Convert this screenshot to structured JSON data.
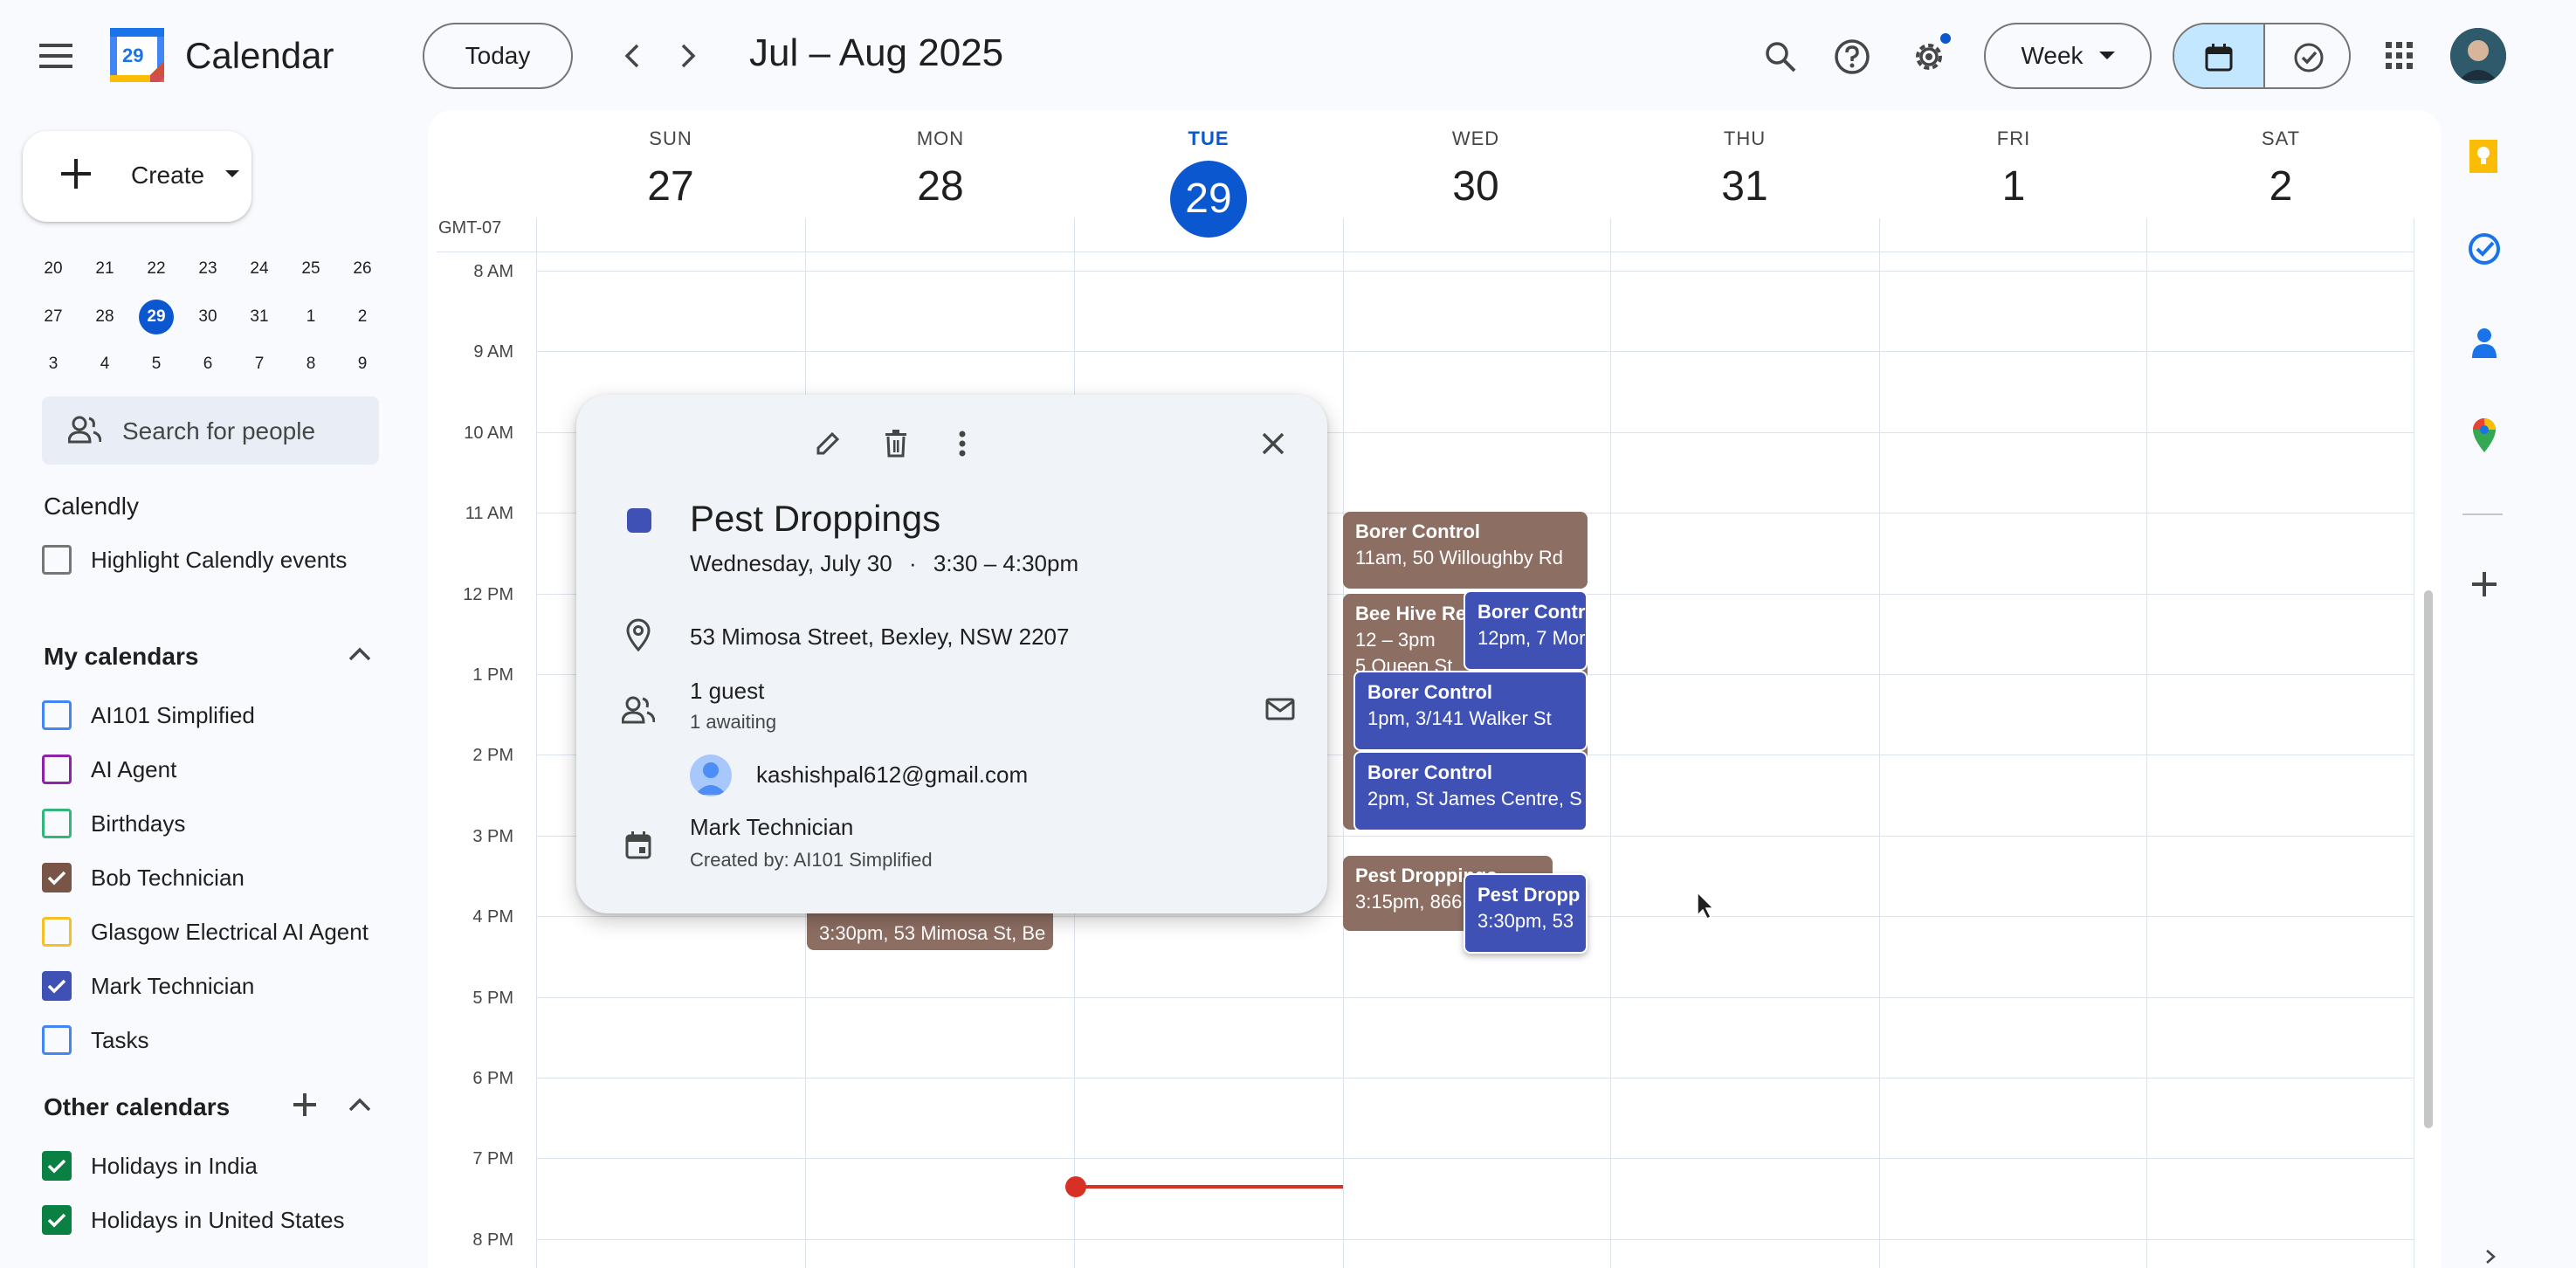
{
  "header": {
    "app_title": "Calendar",
    "logo_day": "29",
    "today_label": "Today",
    "date_range": "Jul – Aug 2025",
    "view_label": "Week"
  },
  "sidebar": {
    "create_label": "Create",
    "mini_calendar": {
      "rows": [
        [
          "20",
          "21",
          "22",
          "23",
          "24",
          "25",
          "26"
        ],
        [
          "27",
          "28",
          "29",
          "30",
          "31",
          "1",
          "2"
        ],
        [
          "3",
          "4",
          "5",
          "6",
          "7",
          "8",
          "9"
        ]
      ],
      "today": "29"
    },
    "search_people_placeholder": "Search for people",
    "calendly": {
      "title": "Calendly",
      "highlight_label": "Highlight Calendly events"
    },
    "my_calendars": {
      "title": "My calendars",
      "items": [
        {
          "label": "AI101 Simplified",
          "color": "#4285f4",
          "checked": false
        },
        {
          "label": "AI Agent",
          "color": "#8e24aa",
          "checked": false
        },
        {
          "label": "Birthdays",
          "color": "#33b679",
          "checked": false
        },
        {
          "label": "Bob Technician",
          "color": "#795548",
          "checked": true
        },
        {
          "label": "Glasgow Electrical AI Agent",
          "color": "#f6bf26",
          "checked": false
        },
        {
          "label": "Mark Technician",
          "color": "#3f51b5",
          "checked": true
        },
        {
          "label": "Tasks",
          "color": "#4285f4",
          "checked": false
        }
      ]
    },
    "other_calendars": {
      "title": "Other calendars",
      "items": [
        {
          "label": "Holidays in India",
          "color": "#0b8043",
          "checked": true
        },
        {
          "label": "Holidays in United States",
          "color": "#0b8043",
          "checked": true
        }
      ]
    }
  },
  "week": {
    "timezone": "GMT-07",
    "days": [
      {
        "name": "SUN",
        "date": "27"
      },
      {
        "name": "MON",
        "date": "28"
      },
      {
        "name": "TUE",
        "date": "29"
      },
      {
        "name": "WED",
        "date": "30"
      },
      {
        "name": "THU",
        "date": "31"
      },
      {
        "name": "FRI",
        "date": "1"
      },
      {
        "name": "SAT",
        "date": "2"
      }
    ],
    "today_index": 2,
    "times": [
      "8 AM",
      "9 AM",
      "10 AM",
      "11 AM",
      "12 PM",
      "1 PM",
      "2 PM",
      "3 PM",
      "4 PM",
      "5 PM",
      "6 PM",
      "7 PM",
      "8 PM"
    ]
  },
  "events": [
    {
      "title": "Borer Control",
      "details": "11am, 50 Willoughby Rd",
      "color": "#8d6e63"
    },
    {
      "title": "Bee Hive Re",
      "details": "12 – 3pm",
      "details2": "5 Queen St",
      "color": "#8d6e63"
    },
    {
      "title": "Borer Contr",
      "details": "12pm, 7 Mor",
      "color": "#3f51b5"
    },
    {
      "title": "Borer Control",
      "details": "1pm, 3/141 Walker St",
      "color": "#3f51b5"
    },
    {
      "title": "Borer Control",
      "details": "2pm, St James Centre, S",
      "color": "#3f51b5"
    },
    {
      "title": "Pest Droppings",
      "details": "3:15pm, 866",
      "color": "#8d6e63"
    },
    {
      "title": "Pest Dropp",
      "details": "3:30pm, 53",
      "color": "#3f51b5"
    },
    {
      "title": "",
      "details": "3:30pm, 53 Mimosa St, Be",
      "color": "#8d6e63"
    }
  ],
  "popup": {
    "title": "Pest Droppings",
    "color": "#3f51b5",
    "date_line": "Wednesday, July 30",
    "separator": "·",
    "time_line": "3:30 – 4:30pm",
    "location": "53 Mimosa Street, Bexley, NSW 2207",
    "guests_count": "1 guest",
    "guests_status": "1 awaiting",
    "guest_email": "kashishpal612@gmail.com",
    "calendar": "Mark Technician",
    "created_by": "Created by: AI101 Simplified"
  }
}
